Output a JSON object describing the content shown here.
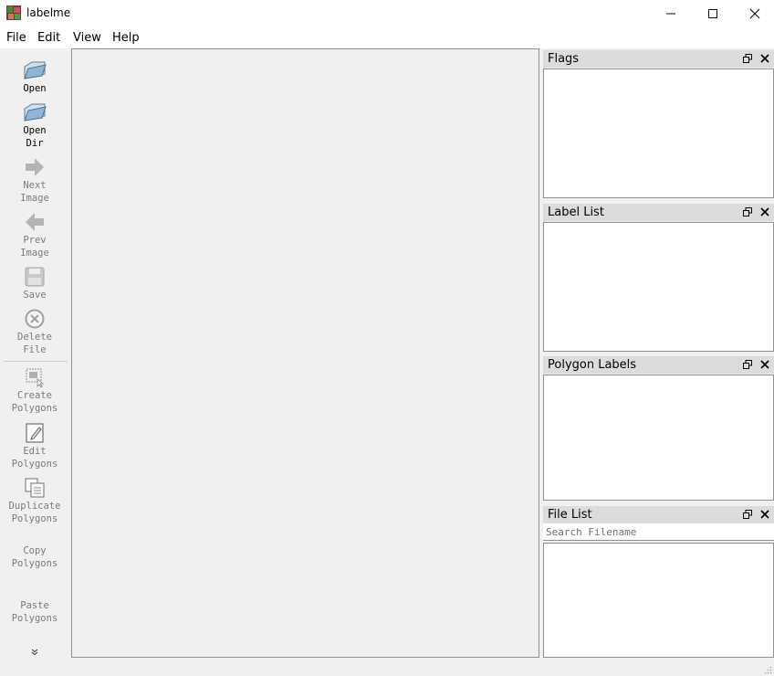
{
  "window": {
    "title": "labelme"
  },
  "menu": {
    "items": [
      "File",
      "Edit",
      "View",
      "Help"
    ]
  },
  "toolbar": {
    "open": "Open",
    "open_dir": [
      "Open",
      "Dir"
    ],
    "next_image": [
      "Next",
      "Image"
    ],
    "prev_image": [
      "Prev",
      "Image"
    ],
    "save": "Save",
    "delete_file": [
      "Delete",
      "File"
    ],
    "create_polygons": [
      "Create",
      "Polygons"
    ],
    "edit_polygons": [
      "Edit",
      "Polygons"
    ],
    "duplicate_polygons": [
      "Duplicate",
      "Polygons"
    ],
    "copy_polygons": [
      "Copy",
      "Polygons"
    ],
    "paste_polygons": [
      "Paste",
      "Polygons"
    ],
    "more_icon": "chevron-double-down-icon"
  },
  "docks": {
    "flags": {
      "title": "Flags"
    },
    "label_list": {
      "title": "Label List"
    },
    "polygon_labels": {
      "title": "Polygon Labels"
    },
    "file_list": {
      "title": "File List",
      "search_placeholder": "Search Filename"
    }
  },
  "icons": {
    "app": "labelme-app-icon",
    "minimize": "minimize-icon",
    "maximize": "maximize-icon",
    "close": "close-icon",
    "open": "folder-open-icon",
    "open_dir": "folder-open-icon",
    "next": "arrow-right-icon",
    "prev": "arrow-left-icon",
    "save": "floppy-disk-icon",
    "delete": "circle-x-icon",
    "create": "create-polygon-icon",
    "edit": "edit-document-icon",
    "duplicate": "duplicate-icon",
    "dock_float": "float-window-icon",
    "dock_close": "close-icon"
  },
  "colors": {
    "titlebar": "#ffffff",
    "background": "#f0f0f0",
    "dock_header": "#dcdcdc",
    "disabled_text": "#7a7a7a"
  }
}
